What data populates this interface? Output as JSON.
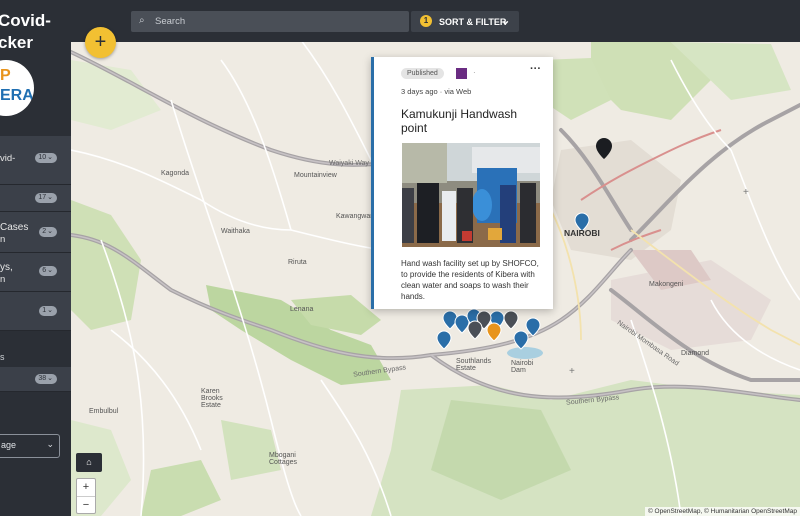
{
  "sidebar": {
    "title_line1": "Covid-",
    "title_line2": "cker",
    "logo_top": "P",
    "logo_bottom": "ERA",
    "filters": [
      {
        "label": "vid-",
        "count": "10"
      },
      {
        "label": "",
        "count": "17"
      },
      {
        "label": "Cases",
        "label2": "n",
        "count": "2"
      },
      {
        "label": "ys,",
        "label2": "n",
        "count": "6"
      },
      {
        "label": "",
        "count": "1"
      }
    ],
    "sub_label": "s",
    "sub_count": "38",
    "language_select": "age"
  },
  "topbar": {
    "search_placeholder": "Search",
    "filter_count": "1",
    "sort_filter_label": "SORT & FILTER",
    "add_label": "+"
  },
  "card": {
    "status": "Published",
    "time": "3 days ago",
    "via": "· via Web",
    "separator": "·",
    "more": "···",
    "title": "Kamukunji Handwash point",
    "description": "Hand wash facility set up by SHOFCO, to provide the residents of Kibera with clean water and soaps to wash their hands."
  },
  "map": {
    "labels": {
      "waiyaki": "Waiyaki Way",
      "kagonda": "Kagonda",
      "mountainview": "Mountainview",
      "kawangware": "Kawangware",
      "waithaka": "Waithaka",
      "riruta": "Riruta",
      "lenana": "Lenana",
      "southern_bypass1": "Southern Bypass",
      "southern_bypass2": "Southern Bypass",
      "nairobi": "NAIROBI",
      "makongeni": "Makongeni",
      "diamond": "Diamond",
      "karen_brooks": "Karen Brooks Estate",
      "mbogani": "Mbogani Cottages",
      "embulbul": "Embulbul",
      "nairobi_dam": "Nairobi Dam",
      "southlands": "Southlands Estate",
      "nairobi_river": "Nairobi Mombasa Road"
    },
    "home_label": "⌂",
    "zoom_in": "+",
    "zoom_out": "−",
    "attribution": "© OpenStreetMap, © Humanitarian OpenStreetMap"
  },
  "colors": {
    "accent": "#f2c032",
    "sidebar": "#2b2f36",
    "marker_blue": "#2a6ea8",
    "marker_dark": "#4a4f57",
    "marker_orange": "#e8941c"
  }
}
